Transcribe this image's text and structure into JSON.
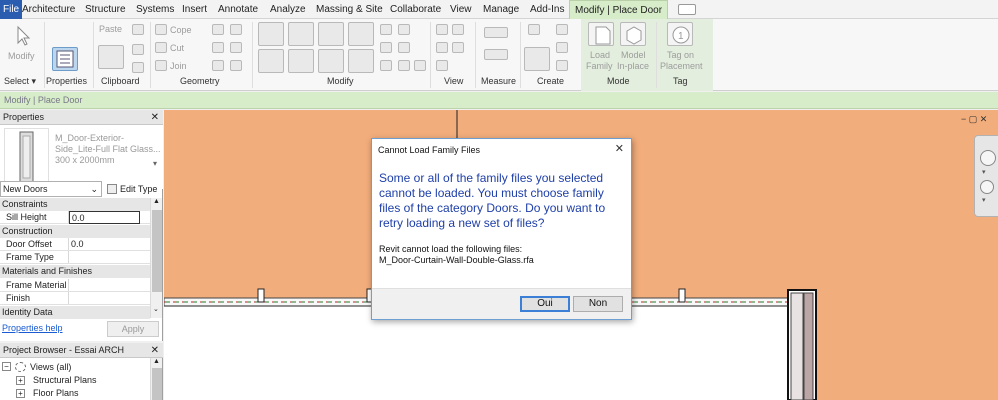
{
  "ribbon_tabs": [
    "File",
    "Architecture",
    "Structure",
    "Systems",
    "Insert",
    "Annotate",
    "Analyze",
    "Massing & Site",
    "Collaborate",
    "View",
    "Manage",
    "Add-Ins",
    "Modify | Place Door"
  ],
  "ribbon": {
    "modify": "Modify",
    "select": "Select",
    "properties": "Properties",
    "paste": "Paste",
    "clipboard": "Clipboard",
    "cope": "Cope",
    "cut": "Cut",
    "join": "Join",
    "geometry": "Geometry",
    "modify_panel": "Modify",
    "view": "View",
    "measure": "Measure",
    "create": "Create",
    "load_family_1": "Load",
    "load_family_2": "Family",
    "model_inplace_1": "Model",
    "model_inplace_2": "In-place",
    "mode": "Mode",
    "tag_on_1": "Tag on",
    "tag_on_2": "Placement",
    "tag": "Tag"
  },
  "context_bar": "Modify | Place Door",
  "properties": {
    "title": "Properties",
    "type_name": "M_Door-Exterior-Side_Lite-Full Flat Glass...",
    "type_line1": "M_Door-Exterior-",
    "type_line2": "Side_Lite-Full Flat Glass...",
    "type_size": "300 x 2000mm",
    "filter": "New Doors",
    "edit_type": "Edit Type",
    "sections": {
      "constraints": "Constraints",
      "construction": "Construction",
      "materials": "Materials and Finishes",
      "identity": "Identity Data"
    },
    "rows": {
      "sill_height": "Sill Height",
      "sill_height_value": "0.0",
      "door_offset": "Door Offset",
      "door_offset_value": "0.0",
      "frame_type": "Frame Type",
      "frame_material": "Frame Material",
      "finish": "Finish"
    },
    "help": "Properties help",
    "apply": "Apply"
  },
  "browser": {
    "title": "Project Browser - Essai ARCH",
    "views": "Views (all)",
    "structural_plans": "Structural Plans",
    "floor_plans": "Floor Plans"
  },
  "dialog": {
    "title": "Cannot Load Family Files",
    "message": "Some or all of the family files you selected cannot be loaded. You must choose family files of the category Doors. Do you want to retry loading a new set of files?",
    "sub_heading": "Revit cannot load the following files:",
    "file": "M_Door-Curtain-Wall-Double-Glass.rfa",
    "yes": "Oui",
    "no": "Non"
  },
  "colors": {
    "canvas": "#f2ad7c",
    "context_green": "#d7ecc9",
    "dialog_text": "#1e3fa8",
    "file_tab": "#2a5db0"
  }
}
